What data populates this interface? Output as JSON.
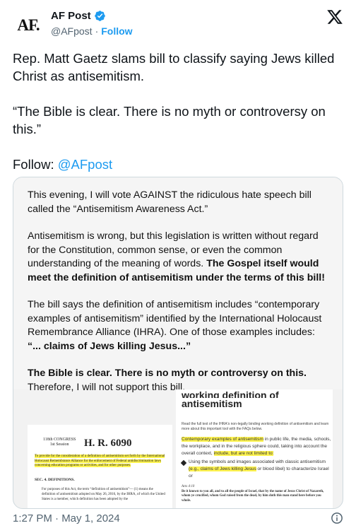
{
  "header": {
    "avatar_text": "AF.",
    "display_name": "AF Post",
    "handle": "@AFpost",
    "separator": "·",
    "follow_label": "Follow",
    "verified_color": "#1d9bf0"
  },
  "tweet": {
    "paragraph1": "Rep. Matt Gaetz slams bill to classify saying Jews killed Christ as antisemitism.",
    "paragraph2": "“The Bible is clear. There is no myth or controversy on this.”",
    "follow_prefix": "Follow: ",
    "follow_mention": "@AFpost",
    "timestamp": "1:27 PM · May 1, 2024"
  },
  "media": {
    "statement": {
      "p1": "This evening, I will vote AGAINST the ridiculous hate speech bill called the “Antisemitism Awareness Act.”",
      "p2_normal": "Antisemitism is wrong, but this legislation is written without regard for the Constitution, common sense, or even the common understanding of the meaning of words. ",
      "p2_bold": "The Gospel itself would meet the definition of antisemitism under the terms of this bill!",
      "p3_normal": "The bill says the definition of antisemitism includes “contemporary examples of antisemitism” identified by the International Holocaust Remembrance Alliance (IHRA). One of those examples includes: ",
      "p3_bold": "“... claims of Jews killing Jesus...”",
      "p4_bold": "The Bible is clear. There is no myth or controversy on this.",
      "p4_normal": " Therefore, I will not support this bill."
    },
    "bill": {
      "congress": "118th CONGRESS\n1st Session",
      "number": "H. R. 6090",
      "purpose_hl": "To provide for the consideration of a definition of antisemitism set forth by the International Holocaust Remembrance Alliance for the enforcement of Federal antidiscrimination laws concerning education programs or activities, and for other purposes.",
      "section": "SEC. 4. DEFINITIONS.",
      "tail": "For purposes of this Act, the term “definition of antisemitism”— (1) means the definition of antisemitism adopted on May 26, 2016, by the IHRA, of which the United States is a member, which definition has been adopted by the"
    },
    "ihra": {
      "cut_title": "working definition of",
      "title": "antisemitism",
      "small": "Read the full text of the IHRA's non-legally binding working definition of antisemitism and learn more about this important tool with the FAQs below.",
      "hl1": "Contemporary examples of antisemitism",
      "body1": " in public life, the media, schools, the workplace, and in the religious sphere could, taking into account the overall context, ",
      "hl2": "include, but are not limited to:",
      "bullet_normal": "Using the symbols and images associated with classic antisemitism ",
      "bullet_hl": "(e.g., claims of Jews killing Jesus",
      "bullet_tail": " or blood libel) to characterize Israel or",
      "acts_ref": "Acts 4:10",
      "acts_text": "Be it known to you all, and to all the people of Israel, that by the name of Jesus Christ of Nazareth, whom ye crucified, whom God raised from the dead, by him doth this man stand here before you whole."
    }
  }
}
